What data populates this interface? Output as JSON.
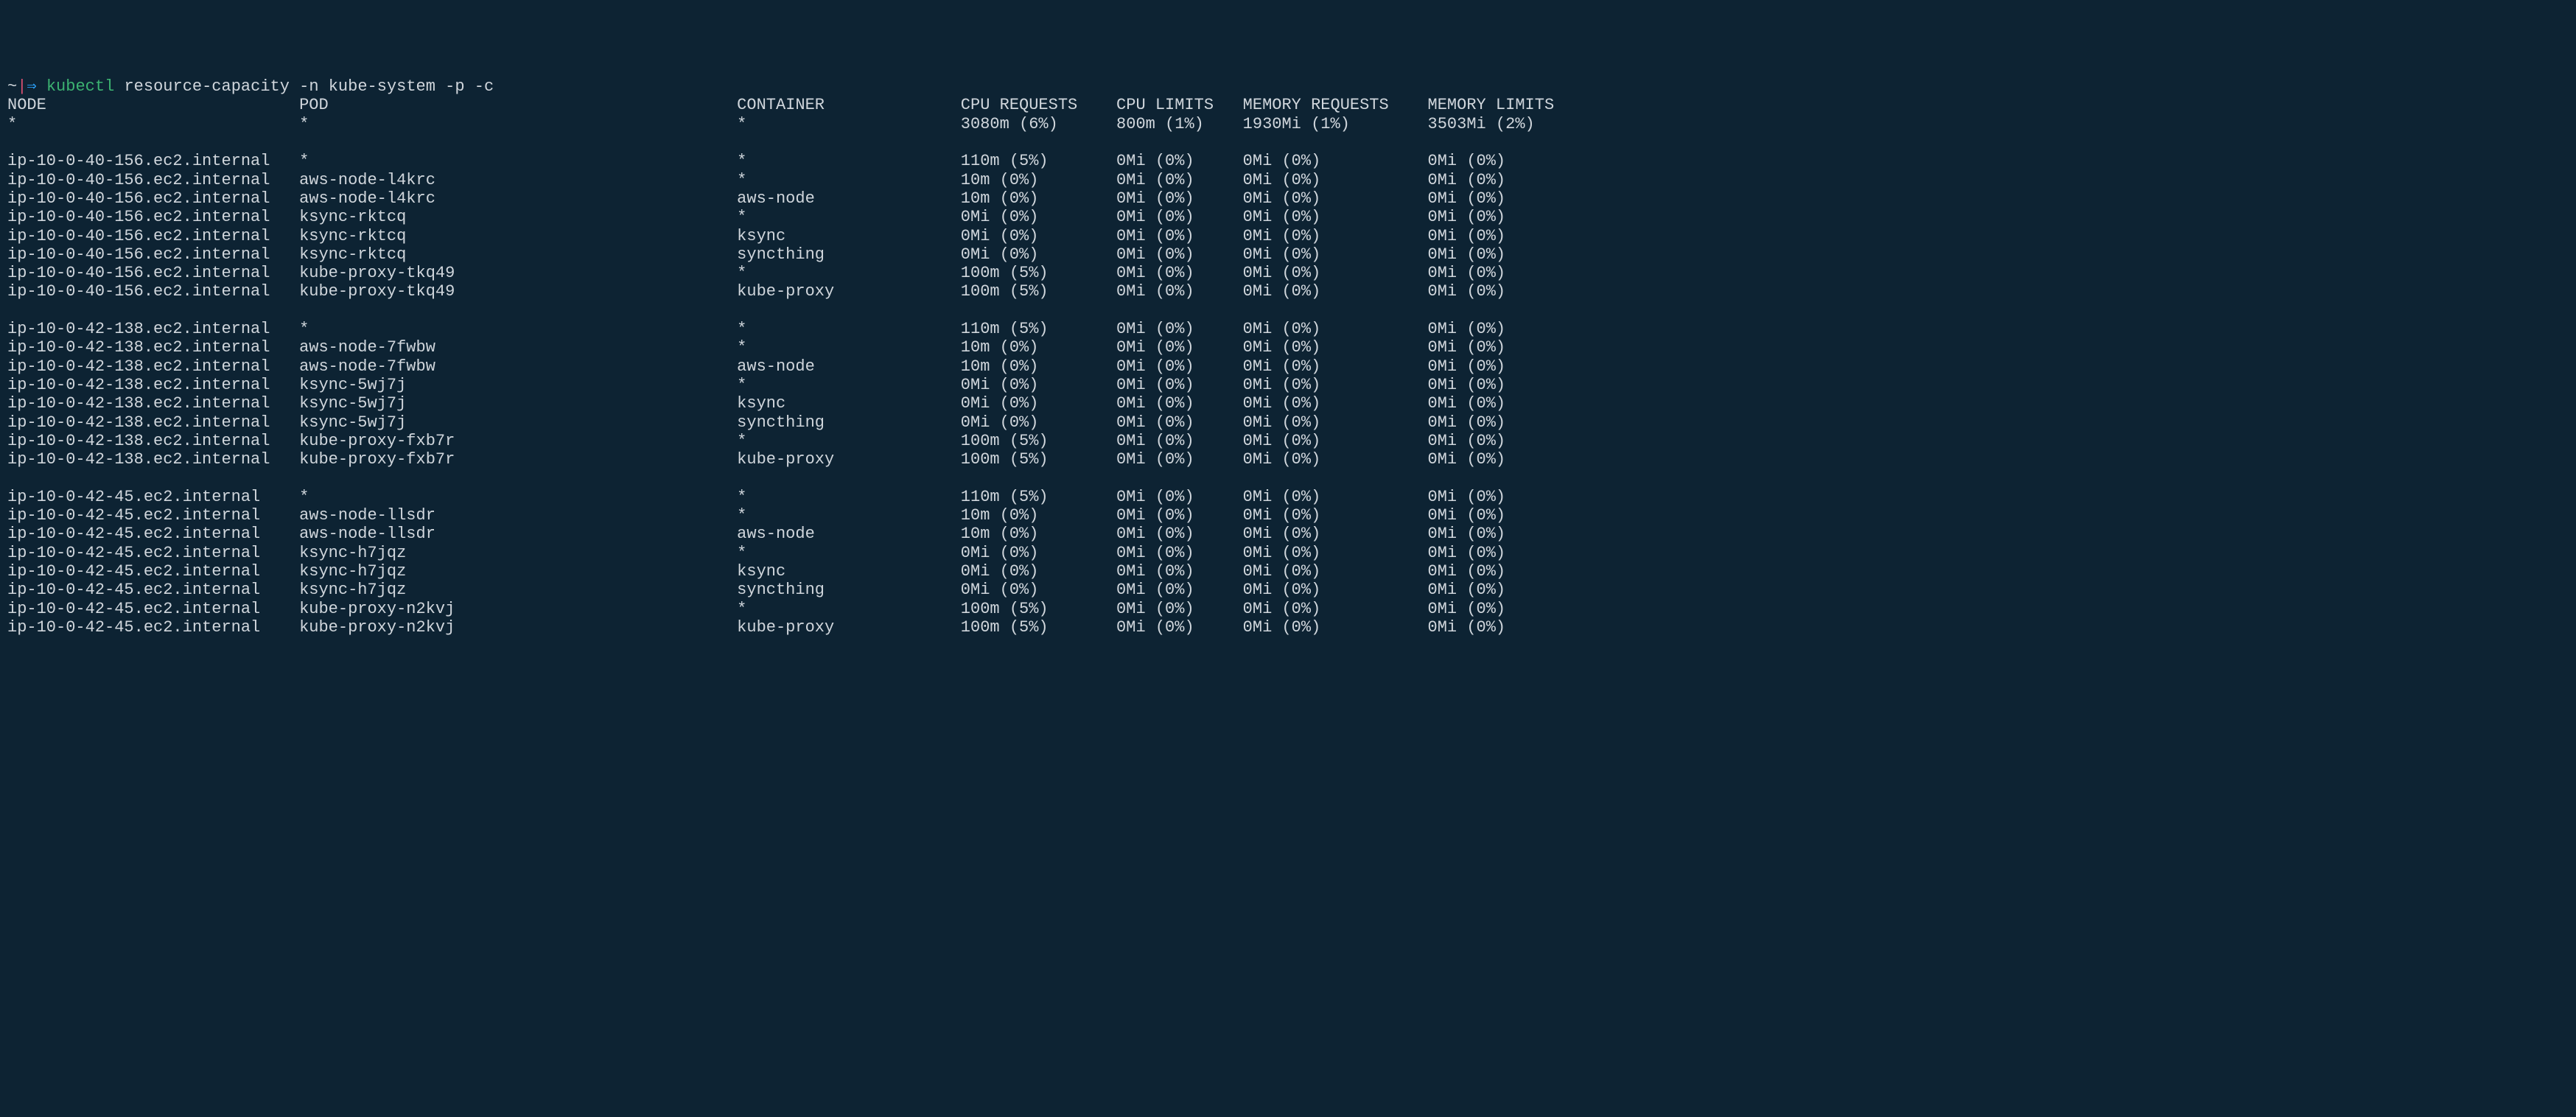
{
  "prompt": {
    "tilde": "~",
    "pipe": "|",
    "arrow": "⇒",
    "command": "kubectl",
    "args": "resource-capacity -n kube-system -p -c"
  },
  "headers": {
    "node": "NODE",
    "pod": "POD",
    "container": "CONTAINER",
    "cpu_requests": "CPU REQUESTS",
    "cpu_limits": "CPU LIMITS",
    "memory_requests": "MEMORY REQUESTS",
    "memory_limits": "MEMORY LIMITS"
  },
  "totals": {
    "node": "*",
    "pod": "*",
    "container": "*",
    "cpu_requests": "3080m (6%)",
    "cpu_limits": "800m (1%)",
    "memory_requests": "1930Mi (1%)",
    "memory_limits": "3503Mi (2%)"
  },
  "groups": [
    {
      "rows": [
        {
          "node": "ip-10-0-40-156.ec2.internal",
          "pod": "*",
          "container": "*",
          "cpu_requests": "110m (5%)",
          "cpu_limits": "0Mi (0%)",
          "memory_requests": "0Mi (0%)",
          "memory_limits": "0Mi (0%)"
        },
        {
          "node": "ip-10-0-40-156.ec2.internal",
          "pod": "aws-node-l4krc",
          "container": "*",
          "cpu_requests": "10m (0%)",
          "cpu_limits": "0Mi (0%)",
          "memory_requests": "0Mi (0%)",
          "memory_limits": "0Mi (0%)"
        },
        {
          "node": "ip-10-0-40-156.ec2.internal",
          "pod": "aws-node-l4krc",
          "container": "aws-node",
          "cpu_requests": "10m (0%)",
          "cpu_limits": "0Mi (0%)",
          "memory_requests": "0Mi (0%)",
          "memory_limits": "0Mi (0%)"
        },
        {
          "node": "ip-10-0-40-156.ec2.internal",
          "pod": "ksync-rktcq",
          "container": "*",
          "cpu_requests": "0Mi (0%)",
          "cpu_limits": "0Mi (0%)",
          "memory_requests": "0Mi (0%)",
          "memory_limits": "0Mi (0%)"
        },
        {
          "node": "ip-10-0-40-156.ec2.internal",
          "pod": "ksync-rktcq",
          "container": "ksync",
          "cpu_requests": "0Mi (0%)",
          "cpu_limits": "0Mi (0%)",
          "memory_requests": "0Mi (0%)",
          "memory_limits": "0Mi (0%)"
        },
        {
          "node": "ip-10-0-40-156.ec2.internal",
          "pod": "ksync-rktcq",
          "container": "syncthing",
          "cpu_requests": "0Mi (0%)",
          "cpu_limits": "0Mi (0%)",
          "memory_requests": "0Mi (0%)",
          "memory_limits": "0Mi (0%)"
        },
        {
          "node": "ip-10-0-40-156.ec2.internal",
          "pod": "kube-proxy-tkq49",
          "container": "*",
          "cpu_requests": "100m (5%)",
          "cpu_limits": "0Mi (0%)",
          "memory_requests": "0Mi (0%)",
          "memory_limits": "0Mi (0%)"
        },
        {
          "node": "ip-10-0-40-156.ec2.internal",
          "pod": "kube-proxy-tkq49",
          "container": "kube-proxy",
          "cpu_requests": "100m (5%)",
          "cpu_limits": "0Mi (0%)",
          "memory_requests": "0Mi (0%)",
          "memory_limits": "0Mi (0%)"
        }
      ]
    },
    {
      "rows": [
        {
          "node": "ip-10-0-42-138.ec2.internal",
          "pod": "*",
          "container": "*",
          "cpu_requests": "110m (5%)",
          "cpu_limits": "0Mi (0%)",
          "memory_requests": "0Mi (0%)",
          "memory_limits": "0Mi (0%)"
        },
        {
          "node": "ip-10-0-42-138.ec2.internal",
          "pod": "aws-node-7fwbw",
          "container": "*",
          "cpu_requests": "10m (0%)",
          "cpu_limits": "0Mi (0%)",
          "memory_requests": "0Mi (0%)",
          "memory_limits": "0Mi (0%)"
        },
        {
          "node": "ip-10-0-42-138.ec2.internal",
          "pod": "aws-node-7fwbw",
          "container": "aws-node",
          "cpu_requests": "10m (0%)",
          "cpu_limits": "0Mi (0%)",
          "memory_requests": "0Mi (0%)",
          "memory_limits": "0Mi (0%)"
        },
        {
          "node": "ip-10-0-42-138.ec2.internal",
          "pod": "ksync-5wj7j",
          "container": "*",
          "cpu_requests": "0Mi (0%)",
          "cpu_limits": "0Mi (0%)",
          "memory_requests": "0Mi (0%)",
          "memory_limits": "0Mi (0%)"
        },
        {
          "node": "ip-10-0-42-138.ec2.internal",
          "pod": "ksync-5wj7j",
          "container": "ksync",
          "cpu_requests": "0Mi (0%)",
          "cpu_limits": "0Mi (0%)",
          "memory_requests": "0Mi (0%)",
          "memory_limits": "0Mi (0%)"
        },
        {
          "node": "ip-10-0-42-138.ec2.internal",
          "pod": "ksync-5wj7j",
          "container": "syncthing",
          "cpu_requests": "0Mi (0%)",
          "cpu_limits": "0Mi (0%)",
          "memory_requests": "0Mi (0%)",
          "memory_limits": "0Mi (0%)"
        },
        {
          "node": "ip-10-0-42-138.ec2.internal",
          "pod": "kube-proxy-fxb7r",
          "container": "*",
          "cpu_requests": "100m (5%)",
          "cpu_limits": "0Mi (0%)",
          "memory_requests": "0Mi (0%)",
          "memory_limits": "0Mi (0%)"
        },
        {
          "node": "ip-10-0-42-138.ec2.internal",
          "pod": "kube-proxy-fxb7r",
          "container": "kube-proxy",
          "cpu_requests": "100m (5%)",
          "cpu_limits": "0Mi (0%)",
          "memory_requests": "0Mi (0%)",
          "memory_limits": "0Mi (0%)"
        }
      ]
    },
    {
      "rows": [
        {
          "node": "ip-10-0-42-45.ec2.internal",
          "pod": "*",
          "container": "*",
          "cpu_requests": "110m (5%)",
          "cpu_limits": "0Mi (0%)",
          "memory_requests": "0Mi (0%)",
          "memory_limits": "0Mi (0%)"
        },
        {
          "node": "ip-10-0-42-45.ec2.internal",
          "pod": "aws-node-llsdr",
          "container": "*",
          "cpu_requests": "10m (0%)",
          "cpu_limits": "0Mi (0%)",
          "memory_requests": "0Mi (0%)",
          "memory_limits": "0Mi (0%)"
        },
        {
          "node": "ip-10-0-42-45.ec2.internal",
          "pod": "aws-node-llsdr",
          "container": "aws-node",
          "cpu_requests": "10m (0%)",
          "cpu_limits": "0Mi (0%)",
          "memory_requests": "0Mi (0%)",
          "memory_limits": "0Mi (0%)"
        },
        {
          "node": "ip-10-0-42-45.ec2.internal",
          "pod": "ksync-h7jqz",
          "container": "*",
          "cpu_requests": "0Mi (0%)",
          "cpu_limits": "0Mi (0%)",
          "memory_requests": "0Mi (0%)",
          "memory_limits": "0Mi (0%)"
        },
        {
          "node": "ip-10-0-42-45.ec2.internal",
          "pod": "ksync-h7jqz",
          "container": "ksync",
          "cpu_requests": "0Mi (0%)",
          "cpu_limits": "0Mi (0%)",
          "memory_requests": "0Mi (0%)",
          "memory_limits": "0Mi (0%)"
        },
        {
          "node": "ip-10-0-42-45.ec2.internal",
          "pod": "ksync-h7jqz",
          "container": "syncthing",
          "cpu_requests": "0Mi (0%)",
          "cpu_limits": "0Mi (0%)",
          "memory_requests": "0Mi (0%)",
          "memory_limits": "0Mi (0%)"
        },
        {
          "node": "ip-10-0-42-45.ec2.internal",
          "pod": "kube-proxy-n2kvj",
          "container": "*",
          "cpu_requests": "100m (5%)",
          "cpu_limits": "0Mi (0%)",
          "memory_requests": "0Mi (0%)",
          "memory_limits": "0Mi (0%)"
        },
        {
          "node": "ip-10-0-42-45.ec2.internal",
          "pod": "kube-proxy-n2kvj",
          "container": "kube-proxy",
          "cpu_requests": "100m (5%)",
          "cpu_limits": "0Mi (0%)",
          "memory_requests": "0Mi (0%)",
          "memory_limits": "0Mi (0%)"
        }
      ]
    }
  ],
  "columns": {
    "node": 30,
    "pod": 45,
    "container": 23,
    "cpu_requests": 16,
    "cpu_limits": 13,
    "memory_requests": 19,
    "memory_limits": 16
  }
}
